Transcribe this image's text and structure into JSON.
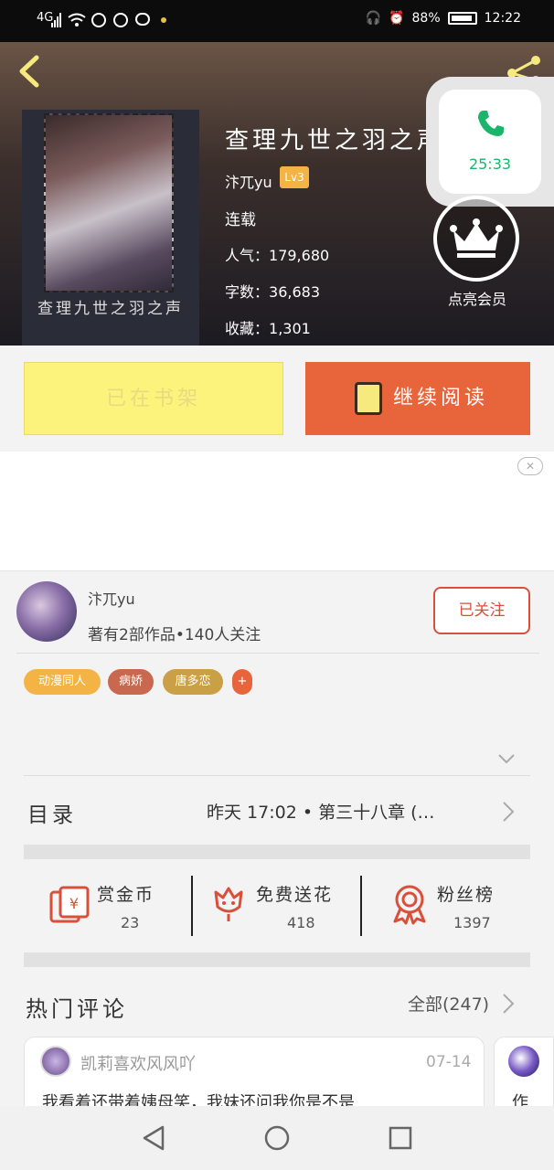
{
  "status_bar": {
    "signal": "4G",
    "battery_percent": "88%",
    "time": "12:22"
  },
  "book": {
    "title": "查理九世之羽之声",
    "cover_title": "查理九世之羽之声",
    "author": "汴兀yu",
    "level": "Lv3",
    "status": "连载",
    "stats": [
      {
        "label": "人气：",
        "value": "179,680"
      },
      {
        "label": "字数：",
        "value": "36,683"
      },
      {
        "label": "收藏：",
        "value": "1,301"
      }
    ]
  },
  "call": {
    "duration": "25:33"
  },
  "vip": {
    "label": "点亮会员"
  },
  "actions": {
    "shelf_label": "已在书架",
    "read_label": "继续阅读"
  },
  "author_section": {
    "name": "汴兀yu",
    "info": "著有2部作品•140人关注",
    "follow_label": "已关注",
    "tags": [
      {
        "label": "动漫同人",
        "color": "#f3b445"
      },
      {
        "label": "病娇",
        "color": "#c8694f"
      },
      {
        "label": "唐多恋",
        "color": "#c9a046"
      },
      {
        "label": "+",
        "color": "#e8653c"
      }
    ]
  },
  "catalog": {
    "label": "目录",
    "latest": "昨天 17:02 • 第三十八章 (…"
  },
  "support": [
    {
      "label": "赏金币",
      "value": "23",
      "icon": "red-envelope-icon"
    },
    {
      "label": "免费送花",
      "value": "418",
      "icon": "flower-icon"
    },
    {
      "label": "粉丝榜",
      "value": "1397",
      "icon": "medal-icon"
    }
  ],
  "comments": {
    "label": "热门评论",
    "all_label": "全部(247)",
    "items": [
      {
        "user": "凯莉喜欢风风吖",
        "date": "07-14",
        "text": "我看着还带着姨母笑，我妹还问我你是不是"
      },
      {
        "user": "",
        "date": "",
        "text": "作"
      }
    ]
  },
  "colors": {
    "accent": "#e8653c",
    "follow": "#d94f3a",
    "call_green": "#1bb46b"
  }
}
